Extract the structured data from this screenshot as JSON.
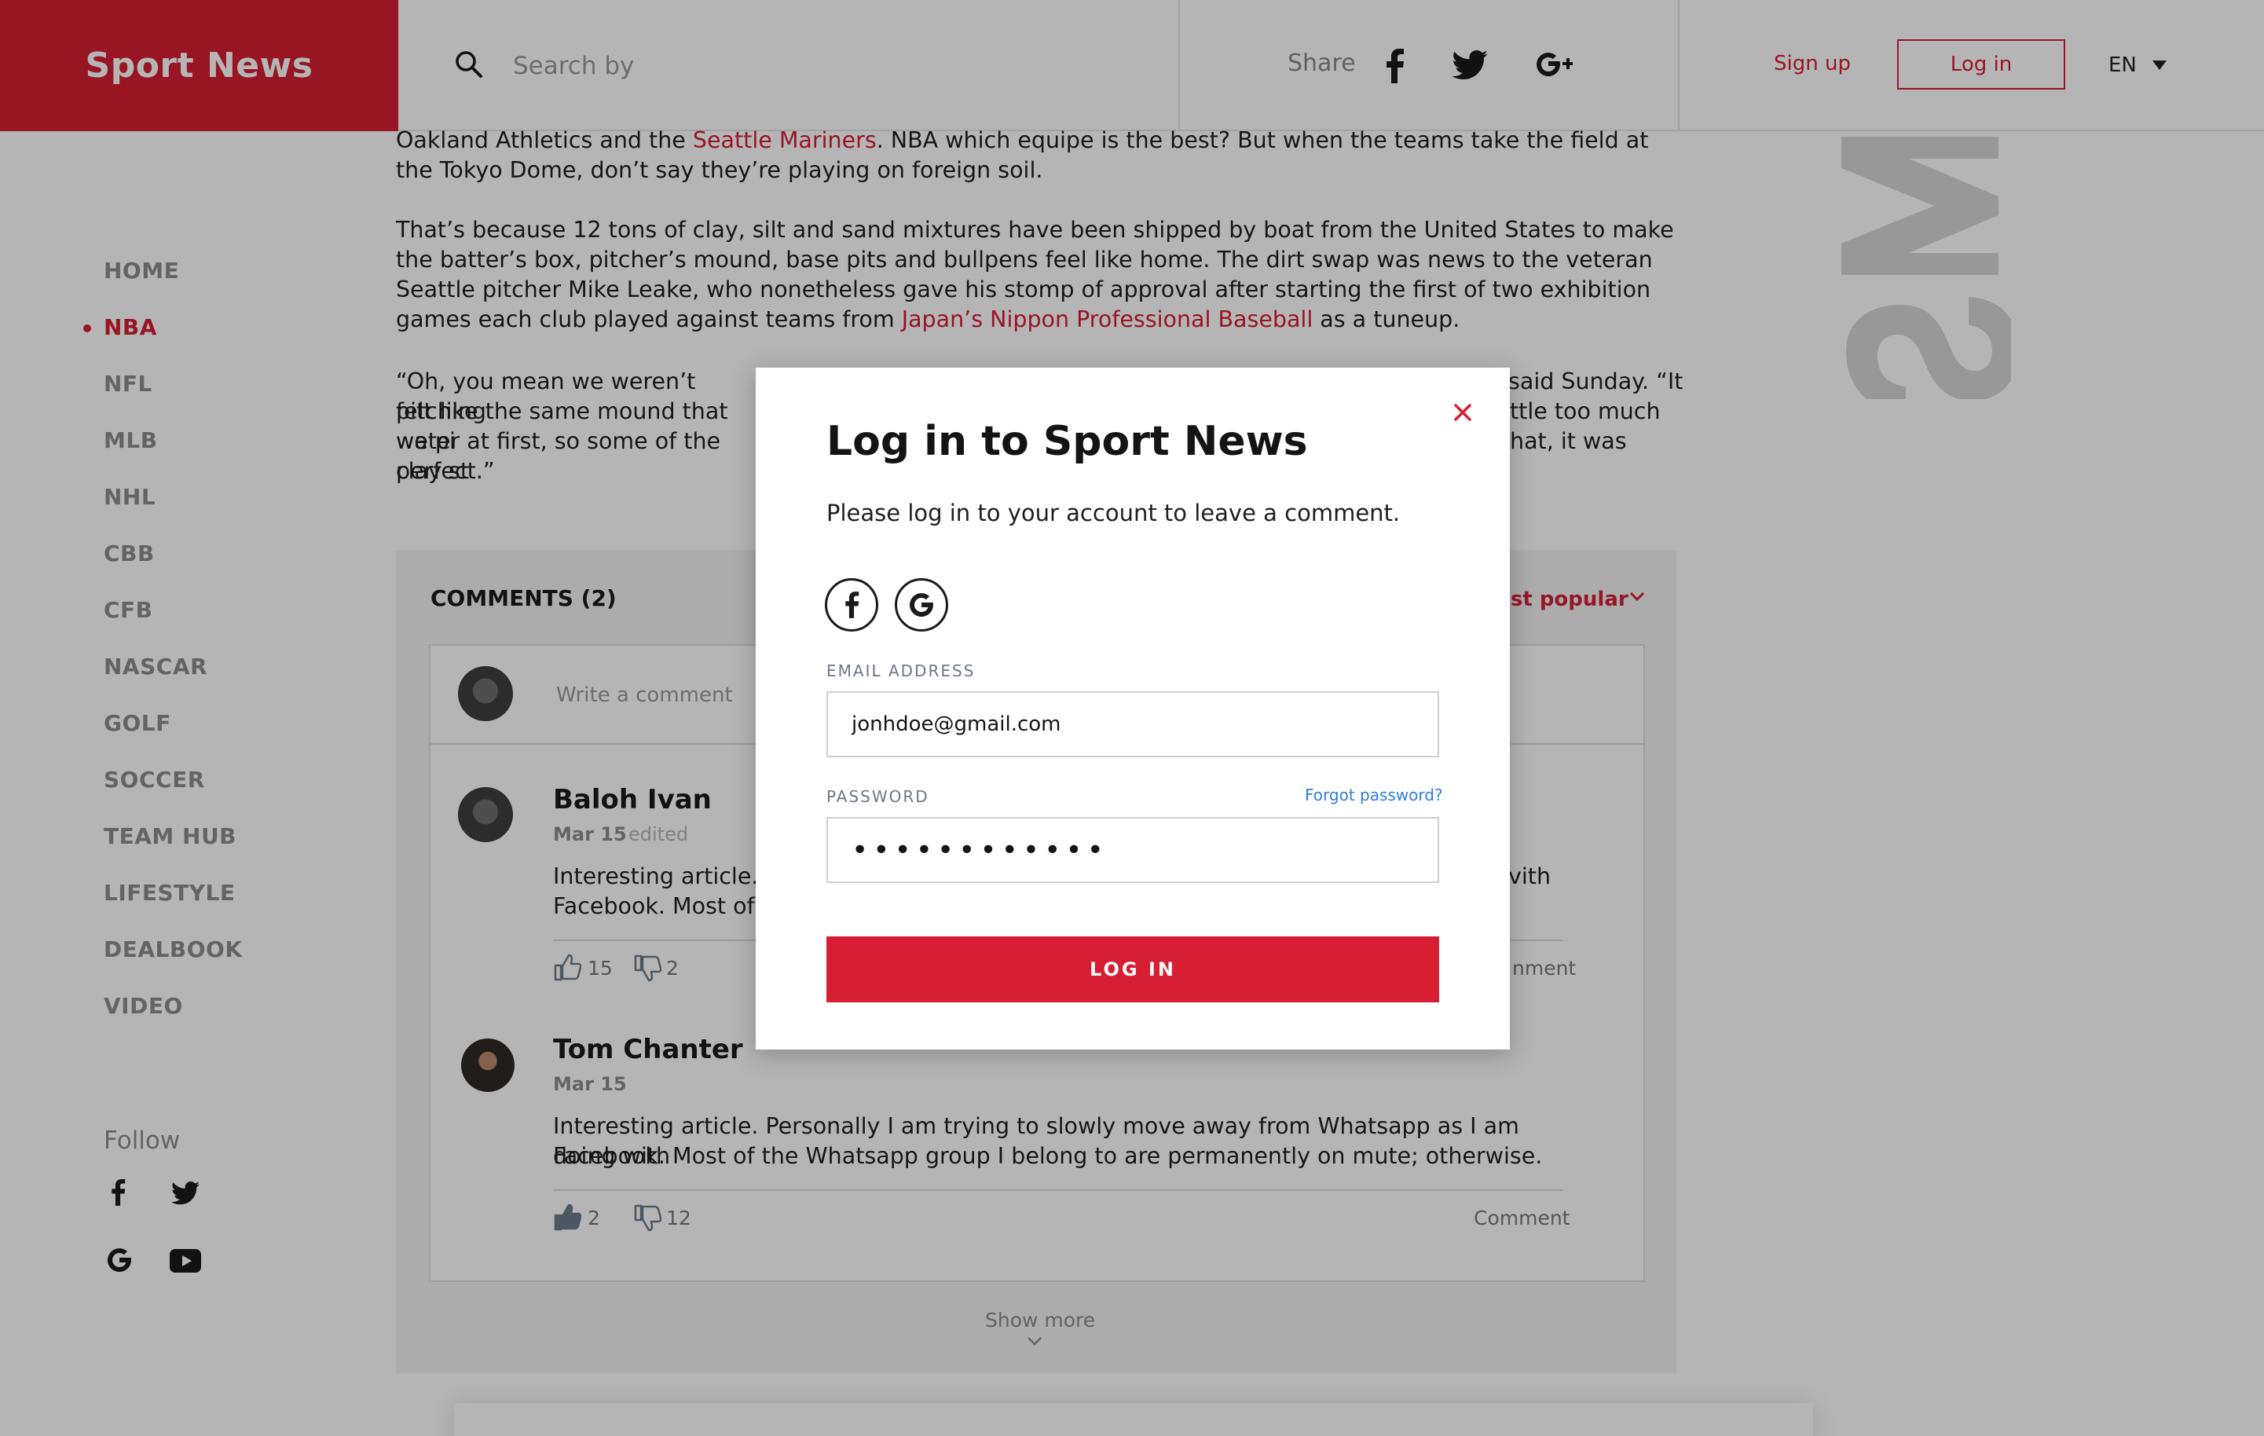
{
  "brand": {
    "name": "Sport News",
    "color": "#d71e32"
  },
  "header": {
    "search_placeholder": "Search by",
    "share_label": "Share",
    "share_icons": [
      "facebook-icon",
      "twitter-icon",
      "google-plus-icon"
    ],
    "signup_label": "Sign up",
    "login_label": "Log in",
    "language": "EN"
  },
  "sidebar": {
    "items": [
      {
        "label": "HOME"
      },
      {
        "label": "NBA"
      },
      {
        "label": "NFL"
      },
      {
        "label": "MLB"
      },
      {
        "label": "NHL"
      },
      {
        "label": "CBB"
      },
      {
        "label": "CFB"
      },
      {
        "label": "NASCAR"
      },
      {
        "label": "GOLF"
      },
      {
        "label": "SOCCER"
      },
      {
        "label": "TEAM HUB"
      },
      {
        "label": "LIFESTYLE"
      },
      {
        "label": "DEALBOOK"
      },
      {
        "label": "VIDEO"
      }
    ],
    "active": "NBA",
    "follow_label": "Follow",
    "follow_icons": [
      "facebook-icon",
      "twitter-icon",
      "google-icon",
      "youtube-icon"
    ]
  },
  "article": {
    "p1_a": "Oakland Athletics and the ",
    "p1_link": "Seattle Mariners",
    "p1_b": ". NBA which equipe is the best? But when the teams take the field at the Tokyo Dome, don’t say they’re playing on foreign soil.",
    "p2_a": "That’s because 12 tons of clay, silt and sand mixtures have been shipped by boat from the United States to make the batter’s box, pitcher’s mound, base pits and bullpens feel like home. The dirt swap was news to the veteran Seattle pitcher Mike Leake, who nonetheless gave his stomp of approval after starting the first of two exhibition games each club played against teams from ",
    "p2_link": "Japan’s Nippon Professional Baseball",
    "p2_b": " as a tuneup.",
    "p3_l1a": "“Oh, you mean we weren’t pitching",
    "p3_l1b": "said Sunday. “It",
    "p3_l2a": "felt like the same mound that we pi",
    "p3_l2b": "ttle too much",
    "p3_l3a": "water at first, so some of the clay st",
    "p3_l3b": "hat, it was",
    "p3_l4": "perfect.”"
  },
  "comments": {
    "title": "COMMENTS (2)",
    "sort_label": "ost popular",
    "write_placeholder": "Write a comment",
    "items": [
      {
        "author": "Baloh Ivan",
        "date": "Mar 15",
        "edited": "edited",
        "line1a": "Interesting article. P",
        "line1b": "vith",
        "line2": "Facebook. Most of t",
        "likes": "15",
        "dislikes": "2",
        "comment_label": "nment"
      },
      {
        "author": "Tom Chanter",
        "date": "Mar 15",
        "line1": "Interesting article. Personally I am trying to slowly move away from Whatsapp as I am doing with",
        "line2": "Facebook. Most of the Whatsapp group I belong to are permanently on mute; otherwise.",
        "likes": "2",
        "dislikes": "12",
        "comment_label": "Comment"
      }
    ],
    "show_more": "Show more"
  },
  "modal": {
    "title": "Log in to Sport News",
    "subtitle": "Please log in to your account to leave a comment.",
    "social_icons": [
      "facebook-icon",
      "google-icon"
    ],
    "email_label": "EMAIL ADDRESS",
    "email_value": "jonhdoe@gmail.com",
    "password_label": "PASSWORD",
    "password_value": "••••••••••••",
    "forgot_label": "Forgot password?",
    "submit_label": "LOG IN"
  }
}
